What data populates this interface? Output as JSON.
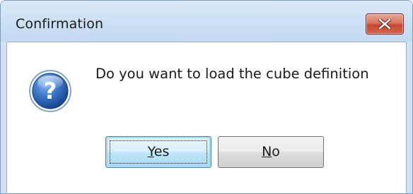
{
  "dialog": {
    "title": "Confirmation",
    "message": "Do you want to load the cube definition",
    "icon": "question-icon",
    "buttons": {
      "yes": {
        "mnemonic": "Y",
        "rest": "es"
      },
      "no": {
        "mnemonic": "N",
        "rest": "o"
      }
    },
    "close_icon": "close-icon",
    "colors": {
      "close_button": "#c6482f",
      "icon_blue": "#2a66b8",
      "default_button_border": "#3c7fb1"
    }
  }
}
